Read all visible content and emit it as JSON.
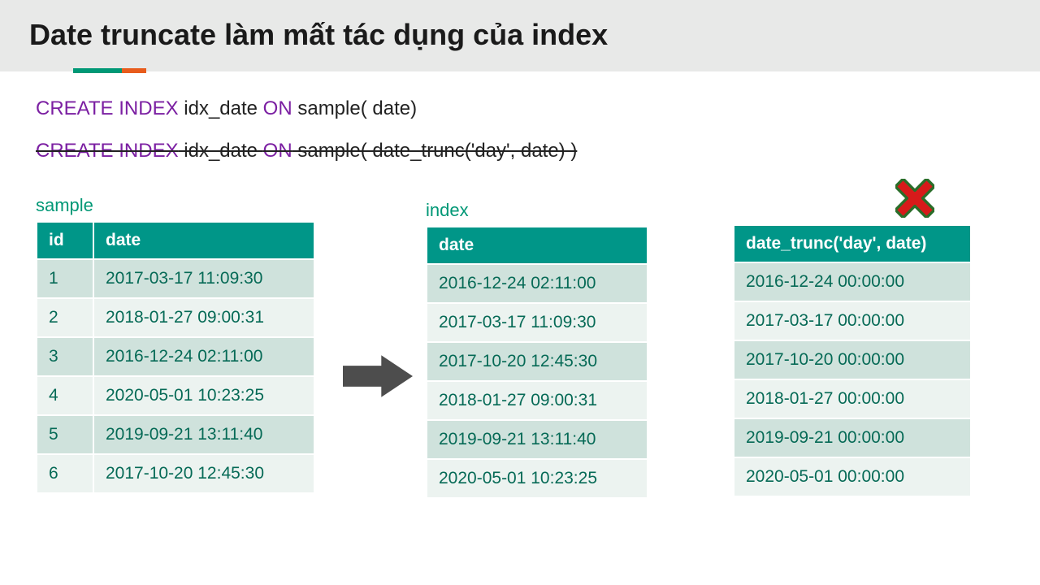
{
  "title": "Date truncate làm mất tác dụng của index",
  "sql1": {
    "kw1": "CREATE INDEX",
    "mid": " idx_date ",
    "kw2": "ON",
    "tail": " sample( date)"
  },
  "sql2": {
    "kw1": "CREATE INDEX",
    "mid": " idx_date ",
    "kw2": "ON",
    "tail": " sample( date_trunc('day', date) )"
  },
  "sample": {
    "title": "sample",
    "cols": [
      "id",
      "date"
    ],
    "rows": [
      [
        "1",
        "2017-03-17 11:09:30"
      ],
      [
        "2",
        "2018-01-27 09:00:31"
      ],
      [
        "3",
        "2016-12-24 02:11:00"
      ],
      [
        "4",
        "2020-05-01 10:23:25"
      ],
      [
        "5",
        "2019-09-21 13:11:40"
      ],
      [
        "6",
        "2017-10-20 12:45:30"
      ]
    ]
  },
  "index": {
    "title": "index",
    "cols": [
      "date"
    ],
    "rows": [
      [
        "2016-12-24 02:11:00"
      ],
      [
        "2017-03-17 11:09:30"
      ],
      [
        "2017-10-20 12:45:30"
      ],
      [
        "2018-01-27 09:00:31"
      ],
      [
        "2019-09-21 13:11:40"
      ],
      [
        "2020-05-01 10:23:25"
      ]
    ]
  },
  "trunc": {
    "cols": [
      "date_trunc('day', date)"
    ],
    "rows": [
      [
        "2016-12-24 00:00:00"
      ],
      [
        "2017-03-17 00:00:00"
      ],
      [
        "2017-10-20 00:00:00"
      ],
      [
        "2018-01-27 00:00:00"
      ],
      [
        "2019-09-21 00:00:00"
      ],
      [
        "2020-05-01 00:00:00"
      ]
    ]
  }
}
